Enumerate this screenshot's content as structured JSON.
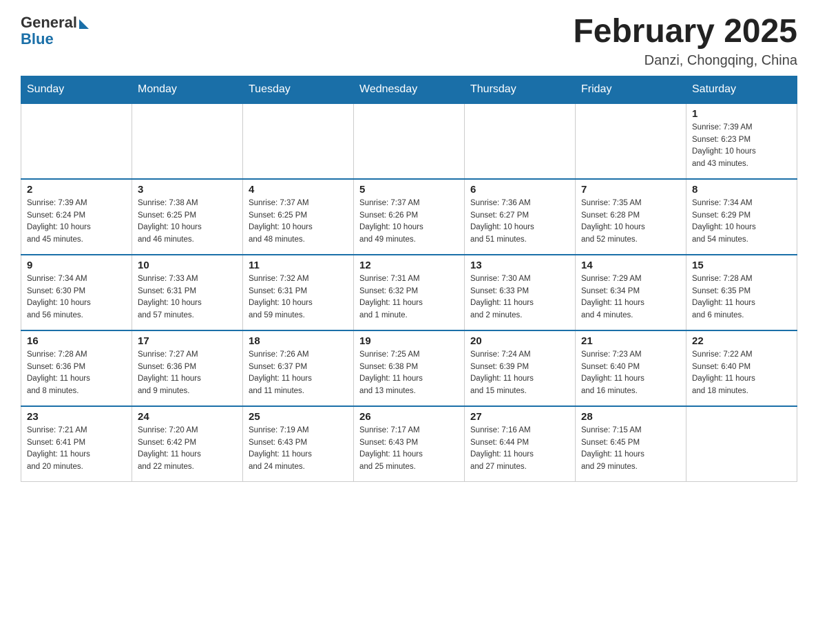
{
  "header": {
    "logo_general": "General",
    "logo_blue": "Blue",
    "month_title": "February 2025",
    "location": "Danzi, Chongqing, China"
  },
  "weekdays": [
    "Sunday",
    "Monday",
    "Tuesday",
    "Wednesday",
    "Thursday",
    "Friday",
    "Saturday"
  ],
  "weeks": [
    [
      {
        "day": "",
        "info": ""
      },
      {
        "day": "",
        "info": ""
      },
      {
        "day": "",
        "info": ""
      },
      {
        "day": "",
        "info": ""
      },
      {
        "day": "",
        "info": ""
      },
      {
        "day": "",
        "info": ""
      },
      {
        "day": "1",
        "info": "Sunrise: 7:39 AM\nSunset: 6:23 PM\nDaylight: 10 hours\nand 43 minutes."
      }
    ],
    [
      {
        "day": "2",
        "info": "Sunrise: 7:39 AM\nSunset: 6:24 PM\nDaylight: 10 hours\nand 45 minutes."
      },
      {
        "day": "3",
        "info": "Sunrise: 7:38 AM\nSunset: 6:25 PM\nDaylight: 10 hours\nand 46 minutes."
      },
      {
        "day": "4",
        "info": "Sunrise: 7:37 AM\nSunset: 6:25 PM\nDaylight: 10 hours\nand 48 minutes."
      },
      {
        "day": "5",
        "info": "Sunrise: 7:37 AM\nSunset: 6:26 PM\nDaylight: 10 hours\nand 49 minutes."
      },
      {
        "day": "6",
        "info": "Sunrise: 7:36 AM\nSunset: 6:27 PM\nDaylight: 10 hours\nand 51 minutes."
      },
      {
        "day": "7",
        "info": "Sunrise: 7:35 AM\nSunset: 6:28 PM\nDaylight: 10 hours\nand 52 minutes."
      },
      {
        "day": "8",
        "info": "Sunrise: 7:34 AM\nSunset: 6:29 PM\nDaylight: 10 hours\nand 54 minutes."
      }
    ],
    [
      {
        "day": "9",
        "info": "Sunrise: 7:34 AM\nSunset: 6:30 PM\nDaylight: 10 hours\nand 56 minutes."
      },
      {
        "day": "10",
        "info": "Sunrise: 7:33 AM\nSunset: 6:31 PM\nDaylight: 10 hours\nand 57 minutes."
      },
      {
        "day": "11",
        "info": "Sunrise: 7:32 AM\nSunset: 6:31 PM\nDaylight: 10 hours\nand 59 minutes."
      },
      {
        "day": "12",
        "info": "Sunrise: 7:31 AM\nSunset: 6:32 PM\nDaylight: 11 hours\nand 1 minute."
      },
      {
        "day": "13",
        "info": "Sunrise: 7:30 AM\nSunset: 6:33 PM\nDaylight: 11 hours\nand 2 minutes."
      },
      {
        "day": "14",
        "info": "Sunrise: 7:29 AM\nSunset: 6:34 PM\nDaylight: 11 hours\nand 4 minutes."
      },
      {
        "day": "15",
        "info": "Sunrise: 7:28 AM\nSunset: 6:35 PM\nDaylight: 11 hours\nand 6 minutes."
      }
    ],
    [
      {
        "day": "16",
        "info": "Sunrise: 7:28 AM\nSunset: 6:36 PM\nDaylight: 11 hours\nand 8 minutes."
      },
      {
        "day": "17",
        "info": "Sunrise: 7:27 AM\nSunset: 6:36 PM\nDaylight: 11 hours\nand 9 minutes."
      },
      {
        "day": "18",
        "info": "Sunrise: 7:26 AM\nSunset: 6:37 PM\nDaylight: 11 hours\nand 11 minutes."
      },
      {
        "day": "19",
        "info": "Sunrise: 7:25 AM\nSunset: 6:38 PM\nDaylight: 11 hours\nand 13 minutes."
      },
      {
        "day": "20",
        "info": "Sunrise: 7:24 AM\nSunset: 6:39 PM\nDaylight: 11 hours\nand 15 minutes."
      },
      {
        "day": "21",
        "info": "Sunrise: 7:23 AM\nSunset: 6:40 PM\nDaylight: 11 hours\nand 16 minutes."
      },
      {
        "day": "22",
        "info": "Sunrise: 7:22 AM\nSunset: 6:40 PM\nDaylight: 11 hours\nand 18 minutes."
      }
    ],
    [
      {
        "day": "23",
        "info": "Sunrise: 7:21 AM\nSunset: 6:41 PM\nDaylight: 11 hours\nand 20 minutes."
      },
      {
        "day": "24",
        "info": "Sunrise: 7:20 AM\nSunset: 6:42 PM\nDaylight: 11 hours\nand 22 minutes."
      },
      {
        "day": "25",
        "info": "Sunrise: 7:19 AM\nSunset: 6:43 PM\nDaylight: 11 hours\nand 24 minutes."
      },
      {
        "day": "26",
        "info": "Sunrise: 7:17 AM\nSunset: 6:43 PM\nDaylight: 11 hours\nand 25 minutes."
      },
      {
        "day": "27",
        "info": "Sunrise: 7:16 AM\nSunset: 6:44 PM\nDaylight: 11 hours\nand 27 minutes."
      },
      {
        "day": "28",
        "info": "Sunrise: 7:15 AM\nSunset: 6:45 PM\nDaylight: 11 hours\nand 29 minutes."
      },
      {
        "day": "",
        "info": ""
      }
    ]
  ]
}
